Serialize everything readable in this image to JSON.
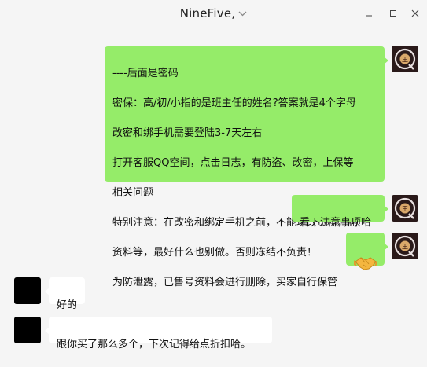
{
  "window": {
    "title": "NineFive,",
    "title_dropdown_icon": "chevron-down-icon",
    "controls": [
      "minimize-icon",
      "maximize-icon",
      "close-icon"
    ]
  },
  "messages": [
    {
      "side": "right",
      "avatar": "q-avatar",
      "lines": [
        "----后面是密码",
        "密保：高/初/小指的是班主任的姓名?答案就是4个字母",
        "改密和绑手机需要登陆3-7天左右",
        "打开客服QQ空间，点击日志，有防盗、改密，上保等",
        "相关问题",
        "特别注意：在改密和绑定手机之前，不能玩改资料，删",
        "资料等，最好什么也别做。否则冻结不负责！",
        "为防泄露，已售号资料会进行删除，买家自行保管"
      ]
    },
    {
      "side": "right",
      "avatar": "q-avatar",
      "text": "看下注意事项哈"
    },
    {
      "side": "right",
      "avatar": "q-avatar",
      "emoji": "handshake-emoji"
    },
    {
      "side": "left",
      "avatar": "black-avatar",
      "text": "好的"
    },
    {
      "side": "left",
      "avatar": "black-avatar",
      "text": "跟你买了那么多个，下次记得给点折扣哈。"
    }
  ],
  "avatar_q": {
    "letter": "Q",
    "inner_char": "王"
  },
  "colors": {
    "background": "#f5f5f5",
    "sent_bubble": "#95ec69",
    "received_bubble": "#ffffff"
  }
}
